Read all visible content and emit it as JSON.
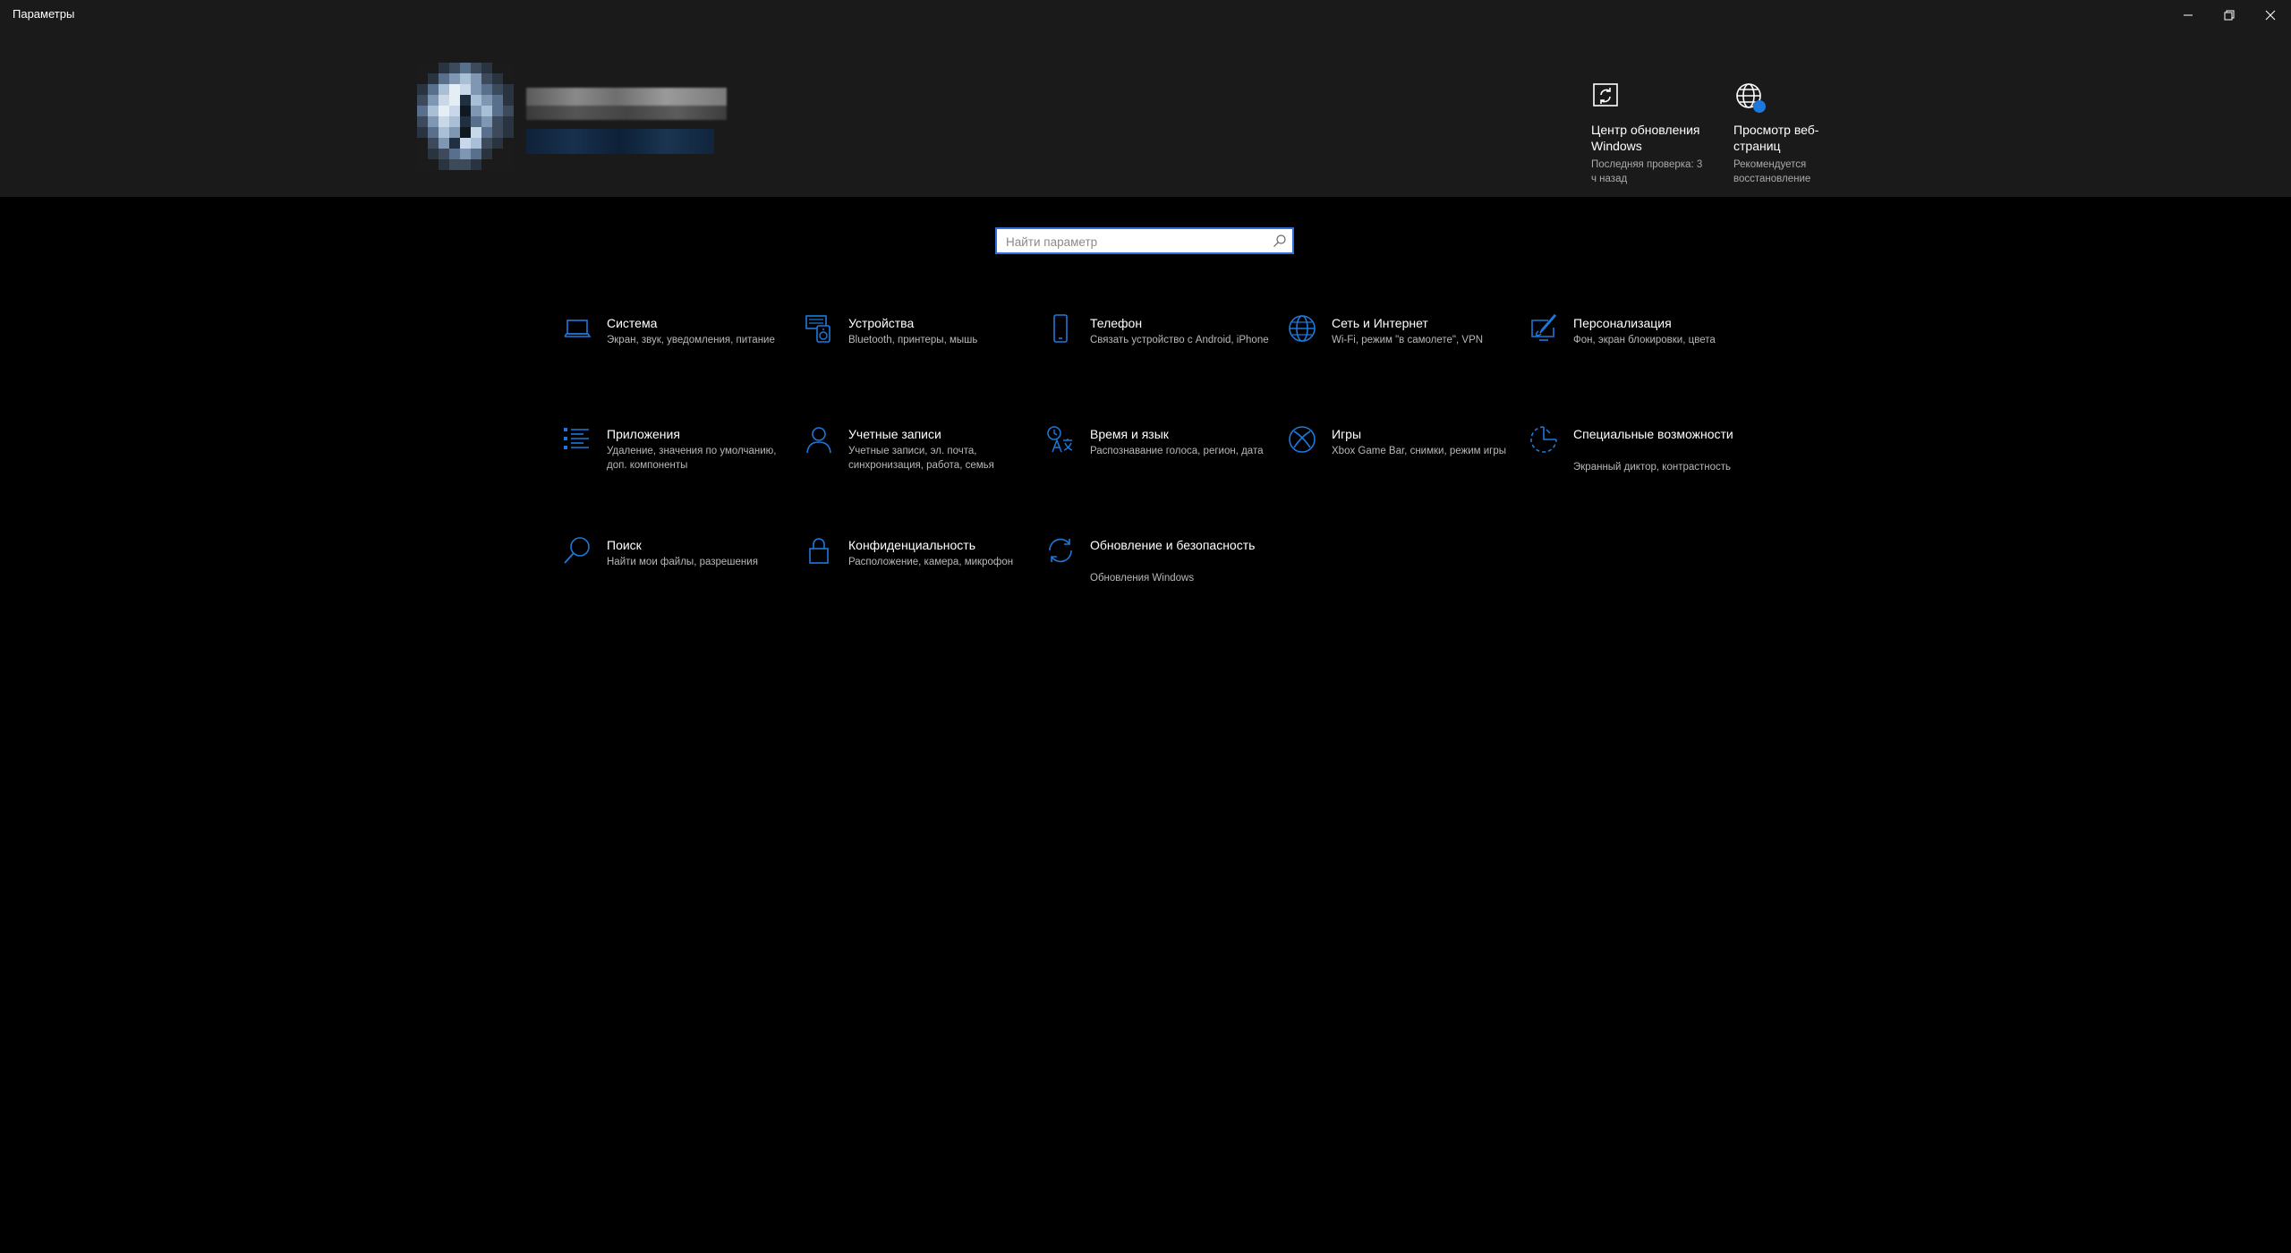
{
  "window": {
    "title": "Параметры",
    "controls": {
      "minimize": "—",
      "restore": "❐",
      "close": "✕"
    }
  },
  "accent_color": "#1e78dc",
  "header": {
    "user": {
      "avatar_icon": "user-avatar-pixelated",
      "name_obscured": true
    },
    "quick_links": [
      {
        "icon": "windows-update-icon",
        "title": "Центр обновления Windows",
        "subtitle": "Последняя проверка: 3 ч назад"
      },
      {
        "icon": "web-browsing-icon",
        "title": "Просмотр веб-страниц",
        "subtitle": "Рекомендуется восстановление"
      }
    ]
  },
  "search": {
    "placeholder": "Найти параметр",
    "value": ""
  },
  "categories": [
    {
      "icon": "laptop-icon",
      "title": "Система",
      "subtitle": "Экран, звук, уведомления, питание"
    },
    {
      "icon": "devices-icon",
      "title": "Устройства",
      "subtitle": "Bluetooth, принтеры, мышь"
    },
    {
      "icon": "phone-icon",
      "title": "Телефон",
      "subtitle": "Связать устройство с Android, iPhone"
    },
    {
      "icon": "globe-icon",
      "title": "Сеть и Интернет",
      "subtitle": "Wi-Fi, режим \"в самолете\", VPN"
    },
    {
      "icon": "personalization-icon",
      "title": "Персонализация",
      "subtitle": "Фон, экран блокировки, цвета"
    },
    {
      "icon": "apps-icon",
      "title": "Приложения",
      "subtitle": "Удаление, значения по умолчанию, доп. компоненты"
    },
    {
      "icon": "accounts-icon",
      "title": "Учетные записи",
      "subtitle": "Учетные записи, эл. почта, синхронизация, работа, семья"
    },
    {
      "icon": "time-language-icon",
      "title": "Время и язык",
      "subtitle": "Распознавание голоса, регион, дата"
    },
    {
      "icon": "xbox-icon",
      "title": "Игры",
      "subtitle": "Xbox Game Bar, снимки, режим игры"
    },
    {
      "icon": "accessibility-icon",
      "title": "Специальные возможности",
      "subtitle": "Экранный диктор, контрастность"
    },
    {
      "icon": "search-icon",
      "title": "Поиск",
      "subtitle": "Найти мои файлы, разрешения"
    },
    {
      "icon": "lock-icon",
      "title": "Конфиденциальность",
      "subtitle": "Расположение, камера, микрофон"
    },
    {
      "icon": "update-security-icon",
      "title": "Обновление и безопасность",
      "subtitle": "Обновления Windows"
    }
  ]
}
